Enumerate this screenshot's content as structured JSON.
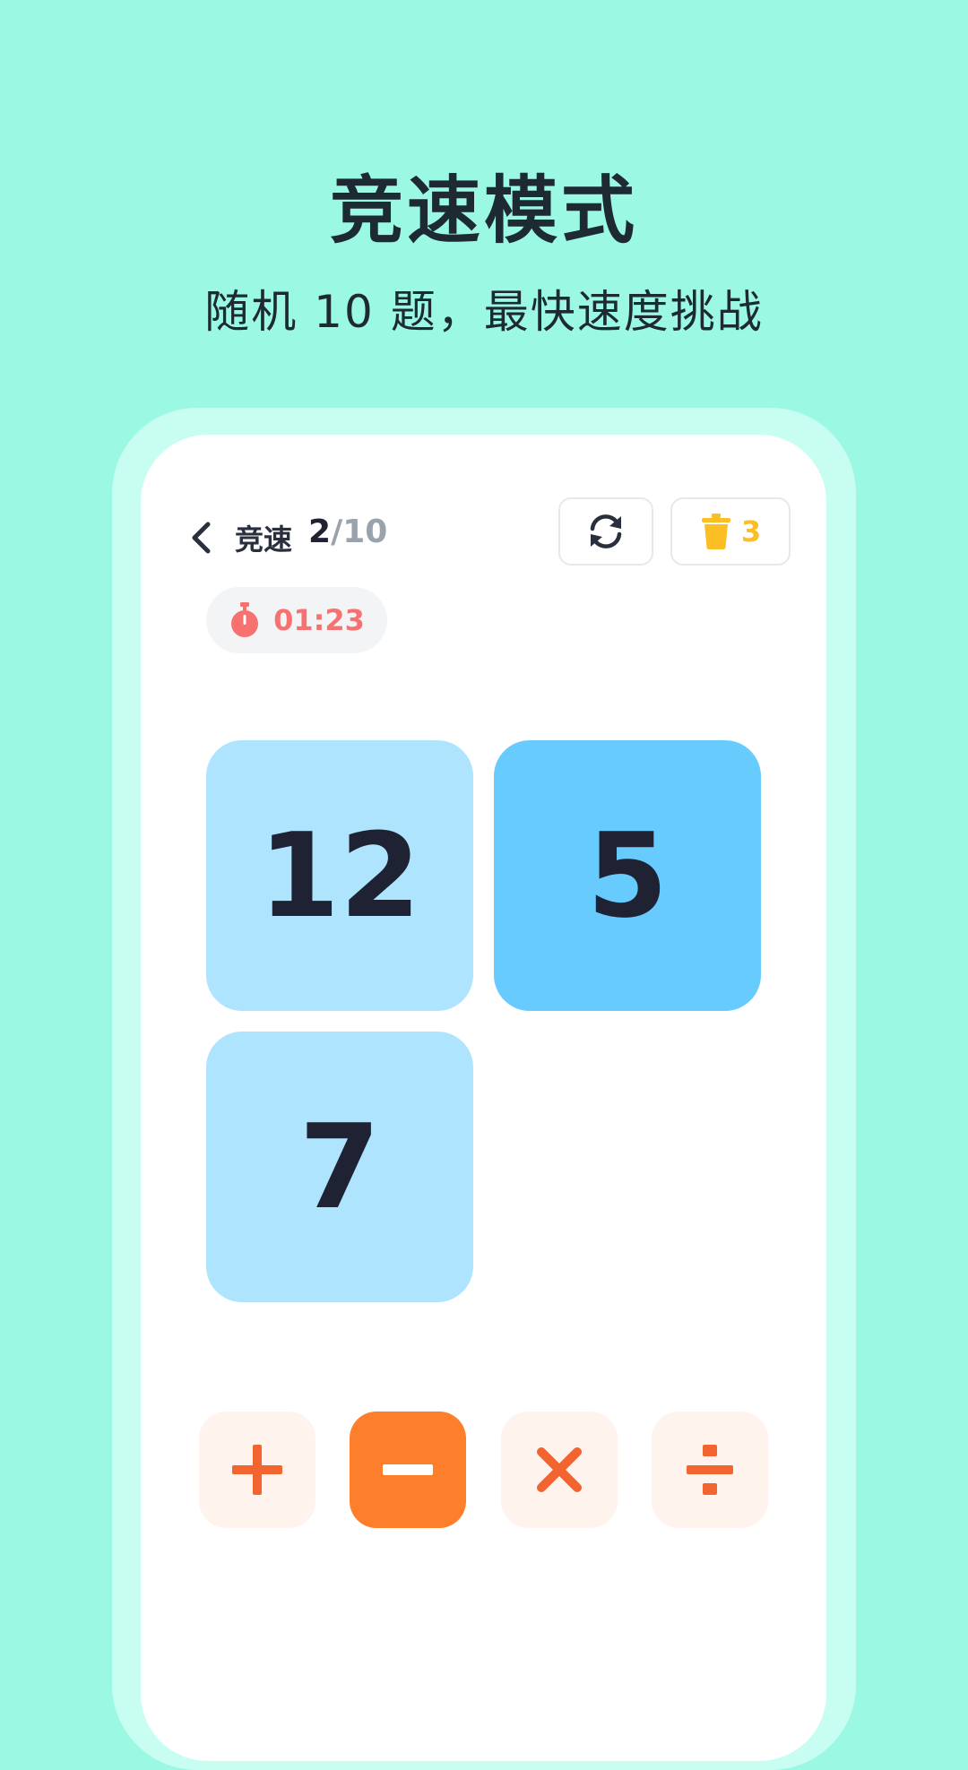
{
  "promo": {
    "title": "竞速模式",
    "subtitle": "随机 10 题，最快速度挑战"
  },
  "header": {
    "mode_label": "竞速",
    "progress_current": "2",
    "progress_separator": "/",
    "progress_total": "10",
    "trash_count": "3"
  },
  "timer": {
    "text": "01:23"
  },
  "cards": [
    {
      "value": "12",
      "selected": false
    },
    {
      "value": "5",
      "selected": true
    },
    {
      "value": "7",
      "selected": false
    }
  ],
  "operators": [
    {
      "symbol": "plus",
      "selected": false
    },
    {
      "symbol": "minus",
      "selected": true
    },
    {
      "symbol": "times",
      "selected": false
    },
    {
      "symbol": "divide",
      "selected": false
    }
  ],
  "colors": {
    "background": "#9af8e3",
    "card_light": "#aee4fe",
    "card_selected": "#68cbfe",
    "operator_accent": "#f26430",
    "operator_active": "#fd7e2b",
    "timer_accent": "#f87171",
    "trash_accent": "#fbbf24"
  }
}
